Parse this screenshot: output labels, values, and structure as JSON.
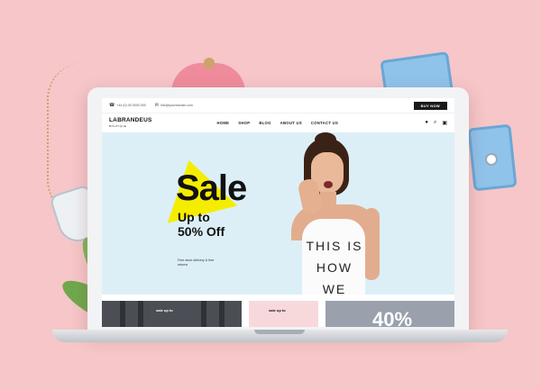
{
  "topbar": {
    "phone": "+44 (0) 00 0000 000",
    "email": "info@yourdomain.com",
    "buy_button": "BUY NOW"
  },
  "header": {
    "logo_main": "LABRANDEUS",
    "logo_sub": "BOUTIQUE",
    "nav": [
      "HOME",
      "SHOP",
      "BLOG",
      "ABOUT US",
      "CONTACT US"
    ],
    "icons": [
      "user-icon",
      "search-icon",
      "cart-icon"
    ]
  },
  "hero": {
    "title": "Sale",
    "subtitle": "Up to 50% Off",
    "note": "Free store delivery & free returns",
    "shirt_text": "THIS IS HOW WE",
    "accent_color": "#f5ed00",
    "background_color": "#dceff7"
  },
  "banners": [
    {
      "label": "sale up to"
    },
    {
      "label": "sale up to"
    },
    {
      "label": "40%"
    }
  ],
  "scene": {
    "background_color": "#f6c6c8"
  }
}
